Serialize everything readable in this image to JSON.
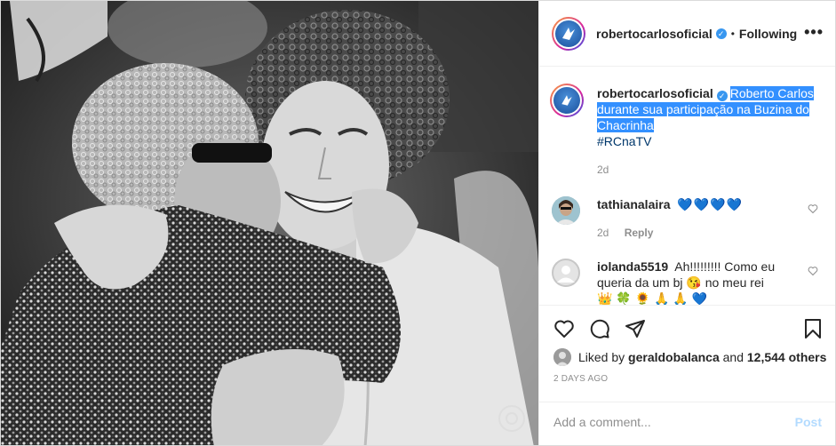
{
  "post": {
    "username": "robertocarlosoficial",
    "separator": "•",
    "follow_status": "Following",
    "more_label": "•••",
    "verified_mark": "✓"
  },
  "caption": {
    "username": "robertocarlosoficial",
    "text_line1": "Roberto Carlos",
    "text_line2": "durante sua participação na Buzina do",
    "text_line3": "Chacrinha",
    "hashtag": "#RCnaTV",
    "time": "2d"
  },
  "comments": [
    {
      "username": "tathianalaira",
      "text": "💙💙💙💙",
      "time": "2d",
      "reply_label": "Reply"
    },
    {
      "username": "iolanda5519",
      "text_line1": "Ah!!!!!!!!! Como eu",
      "text_line2": "queria da um bj 😘 no meu rei",
      "text_line3": "👑 🍀 🌻 🙏 🙏 💙"
    }
  ],
  "likes": {
    "prefix": "Liked by",
    "user": "geraldobalanca",
    "middle": "and",
    "count": "12,544 others"
  },
  "timestamp": "2 DAYS AGO",
  "add_comment": {
    "placeholder": "Add a comment...",
    "post_label": "Post"
  },
  "icons": {
    "like": "heart-icon",
    "comment": "comment-icon",
    "share": "share-icon",
    "save": "bookmark-icon"
  },
  "colors": {
    "verified": "#3897f0",
    "selection": "#3390ff",
    "hashtag": "#00376b",
    "post_disabled": "#b3dbff"
  }
}
